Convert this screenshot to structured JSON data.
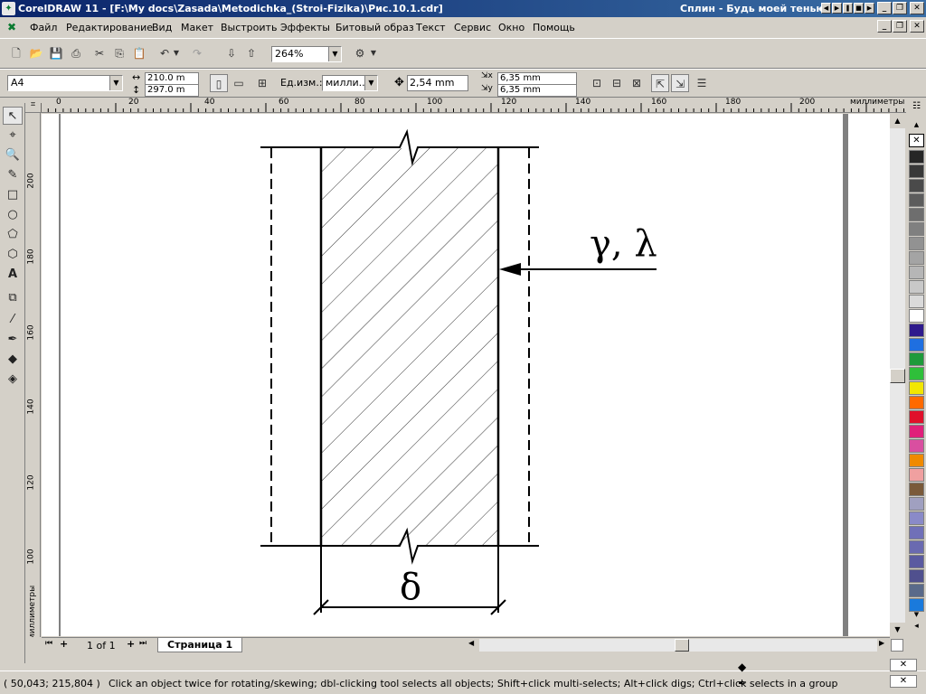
{
  "app": {
    "title": "CorelDRAW 11 - [F:\\My docs\\Zasada\\Metodichka_(Stroi-Fizika)\\Рис.10.1.cdr]",
    "player_song": "Сплин - Будь моей тенью"
  },
  "menu": {
    "items": [
      "Файл",
      "Редактирование",
      "Вид",
      "Макет",
      "Выстроить",
      "Эффекты",
      "Битовый образ",
      "Текст",
      "Сервис",
      "Окно",
      "Помощь"
    ]
  },
  "toolbar": {
    "zoom": "264%"
  },
  "property_bar": {
    "page_size": "A4",
    "width": "210.0 m",
    "height": "297.0 m",
    "units_label": "Ед.изм.:",
    "units": "милли...",
    "nudge": "2,54 mm",
    "dup_x": "6,35 mm",
    "dup_y": "6,35 mm"
  },
  "rulers": {
    "h_ticks": [
      "0",
      "20",
      "40",
      "60",
      "80",
      "100",
      "120",
      "140",
      "160",
      "180",
      "200"
    ],
    "h_unit": "миллиметры",
    "v_ticks": [
      "200",
      "180",
      "160",
      "140",
      "120",
      "100"
    ],
    "v_unit": "миллиметры"
  },
  "drawing": {
    "label_top": "γ, λ",
    "label_bottom": "δ"
  },
  "page_tabs": {
    "page_count": "1 of 1",
    "tab": "Страница 1"
  },
  "status": {
    "coords": "( 50,043; 215,804 )",
    "hint": "Click an object twice for rotating/skewing; dbl-clicking tool selects all objects; Shift+click multi-selects; Alt+click digs; Ctrl+click selects in a group"
  },
  "palette": {
    "colors": [
      "#262626",
      "#383838",
      "#4a4a4a",
      "#5c5c5c",
      "#6e6e6e",
      "#808080",
      "#929292",
      "#a4a4a4",
      "#b6b6b6",
      "#c8c8c8",
      "#dadada",
      "#ffffff",
      "#2e1a8c",
      "#1f6fe0",
      "#1e9a3a",
      "#2fbf3a",
      "#f2e600",
      "#ff6a00",
      "#e0102a",
      "#e0207a",
      "#d94fa0",
      "#f08a00",
      "#f0a0a0",
      "#7a5a3a",
      "#a0a0c0",
      "#8a8ac8",
      "#7070b8",
      "#6a6ab0",
      "#5a5aa0",
      "#50508e",
      "#5a6a8a",
      "#1a7adc"
    ]
  }
}
